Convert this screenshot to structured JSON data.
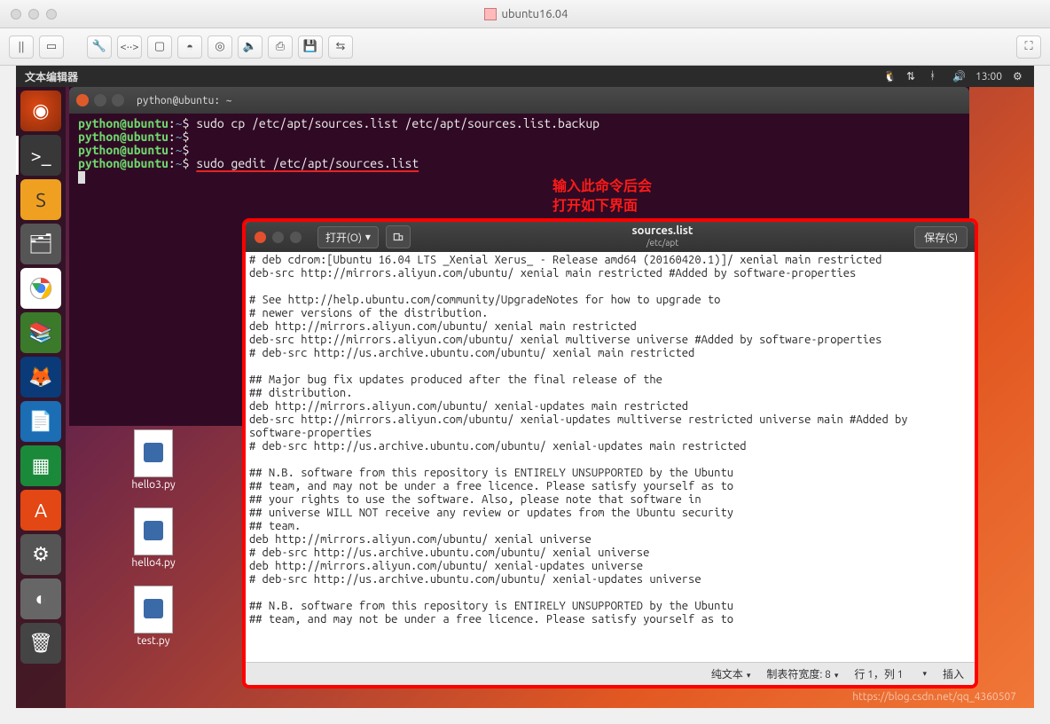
{
  "mac": {
    "title": "ubuntu16.04"
  },
  "panel": {
    "app_title": "文本编辑器",
    "time": "13:00"
  },
  "launcher": {
    "items": [
      {
        "name": "ubuntu-dash",
        "glyph": "◎"
      },
      {
        "name": "terminal",
        "glyph": ">_"
      },
      {
        "name": "sublime",
        "glyph": "S"
      },
      {
        "name": "files",
        "glyph": "🗂"
      },
      {
        "name": "chrome",
        "glyph": "◉"
      },
      {
        "name": "books",
        "glyph": "📚"
      },
      {
        "name": "firefox",
        "glyph": "🦊"
      },
      {
        "name": "writer",
        "glyph": "📄"
      },
      {
        "name": "calc",
        "glyph": "▦"
      },
      {
        "name": "software",
        "glyph": "A"
      },
      {
        "name": "settings",
        "glyph": "⚙"
      },
      {
        "name": "updates",
        "glyph": "◐"
      },
      {
        "name": "trash",
        "glyph": "🗑"
      }
    ]
  },
  "terminal": {
    "title": "python@ubuntu: ~",
    "prompt_user": "python@ubuntu",
    "prompt_sep": ":",
    "prompt_path": "~",
    "prompt_char": "$",
    "line1_cmd": "sudo cp /etc/apt/sources.list /etc/apt/sources.list.backup",
    "line4_cmd": "sudo gedit /etc/apt/sources.list"
  },
  "annotation": {
    "line1": "输入此命令后会",
    "line2": "打开如下界面"
  },
  "desktop": {
    "file1": "hello3.py",
    "file2": "hello4.py",
    "file3": "test.py"
  },
  "gedit": {
    "open_label": "打开(O)",
    "save_label": "保存(S)",
    "filename": "sources.list",
    "filepath": "/etc/apt",
    "body": "# deb cdrom:[Ubuntu 16.04 LTS _Xenial Xerus_ - Release amd64 (20160420.1)]/ xenial main restricted\ndeb-src http://mirrors.aliyun.com/ubuntu/ xenial main restricted #Added by software-properties\n\n# See http://help.ubuntu.com/community/UpgradeNotes for how to upgrade to\n# newer versions of the distribution.\ndeb http://mirrors.aliyun.com/ubuntu/ xenial main restricted\ndeb-src http://mirrors.aliyun.com/ubuntu/ xenial multiverse universe #Added by software-properties\n# deb-src http://us.archive.ubuntu.com/ubuntu/ xenial main restricted\n\n## Major bug fix updates produced after the final release of the\n## distribution.\ndeb http://mirrors.aliyun.com/ubuntu/ xenial-updates main restricted\ndeb-src http://mirrors.aliyun.com/ubuntu/ xenial-updates multiverse restricted universe main #Added by software-properties\n# deb-src http://us.archive.ubuntu.com/ubuntu/ xenial-updates main restricted\n\n## N.B. software from this repository is ENTIRELY UNSUPPORTED by the Ubuntu\n## team, and may not be under a free licence. Please satisfy yourself as to\n## your rights to use the software. Also, please note that software in\n## universe WILL NOT receive any review or updates from the Ubuntu security\n## team.\ndeb http://mirrors.aliyun.com/ubuntu/ xenial universe\n# deb-src http://us.archive.ubuntu.com/ubuntu/ xenial universe\ndeb http://mirrors.aliyun.com/ubuntu/ xenial-updates universe\n# deb-src http://us.archive.ubuntu.com/ubuntu/ xenial-updates universe\n\n## N.B. software from this repository is ENTIRELY UNSUPPORTED by the Ubuntu\n## team, and may not be under a free licence. Please satisfy yourself as to",
    "status": {
      "plaintext": "纯文本",
      "tabwidth_label": "制表符宽度: 8",
      "position": "行 1，列 1",
      "insert": "插入"
    }
  },
  "watermark": "https://blog.csdn.net/qq_4360507"
}
